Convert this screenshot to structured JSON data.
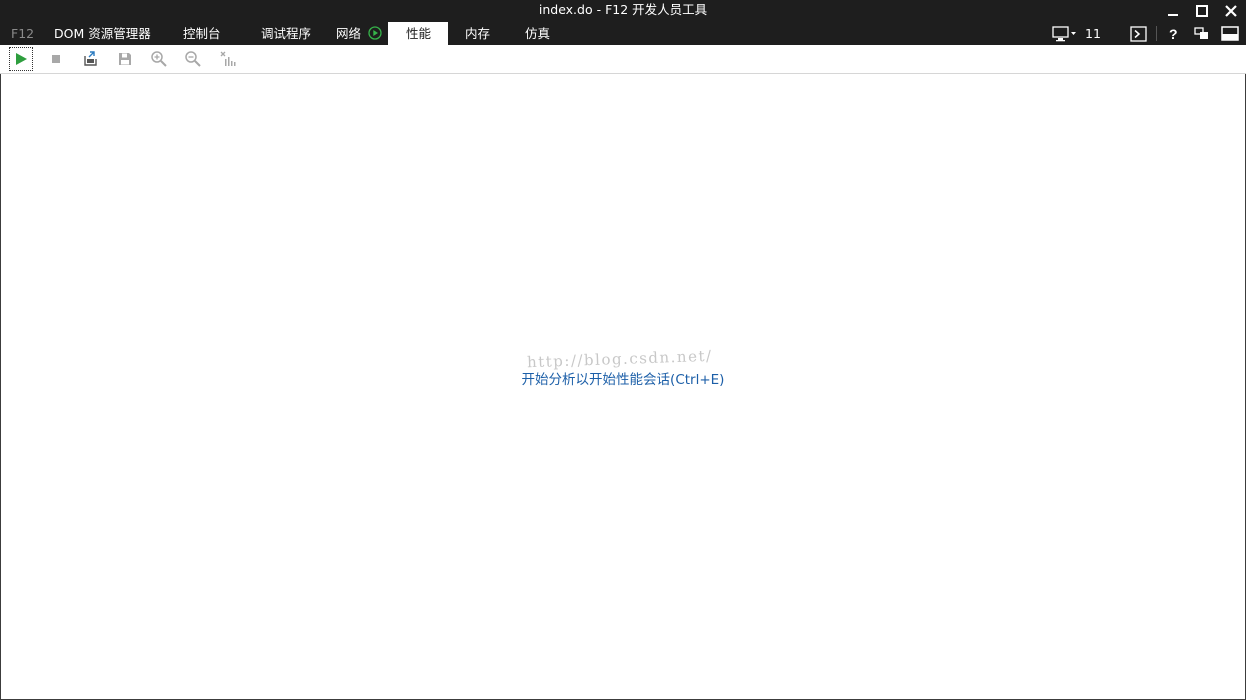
{
  "window": {
    "title": "index.do - F12 开发人员工具",
    "minimize_icon": "minimize-icon",
    "maximize_icon": "maximize-icon",
    "close_icon": "close-icon"
  },
  "tabs": [
    {
      "label": "F12"
    },
    {
      "label": "DOM 资源管理器"
    },
    {
      "label": "控制台"
    },
    {
      "label": "调试程序"
    },
    {
      "label": "网络",
      "icon": "play-circle-icon"
    },
    {
      "label": "性能",
      "active": true
    },
    {
      "label": "内存"
    },
    {
      "label": "仿真"
    }
  ],
  "right_tools": {
    "target_icon": "monitor-icon",
    "count": "11",
    "console_icon": "console-icon",
    "help_icon": "help-icon",
    "undock_icon": "undock-icon",
    "dock_icon": "dock-bottom-icon"
  },
  "toolbar": {
    "buttons": [
      {
        "icon": "start-profiling-icon"
      },
      {
        "icon": "stop-icon"
      },
      {
        "icon": "import-icon"
      },
      {
        "icon": "save-icon"
      },
      {
        "icon": "zoom-in-icon"
      },
      {
        "icon": "zoom-out-icon"
      },
      {
        "icon": "clear-chart-icon"
      }
    ]
  },
  "content": {
    "watermark": "http://blog.csdn.net/",
    "hint": "开始分析以开始性能会话(Ctrl+E)"
  },
  "colors": {
    "chrome_bg": "#1e1e1e",
    "link": "#1c5fa8",
    "play_green": "#2e9e3e"
  }
}
